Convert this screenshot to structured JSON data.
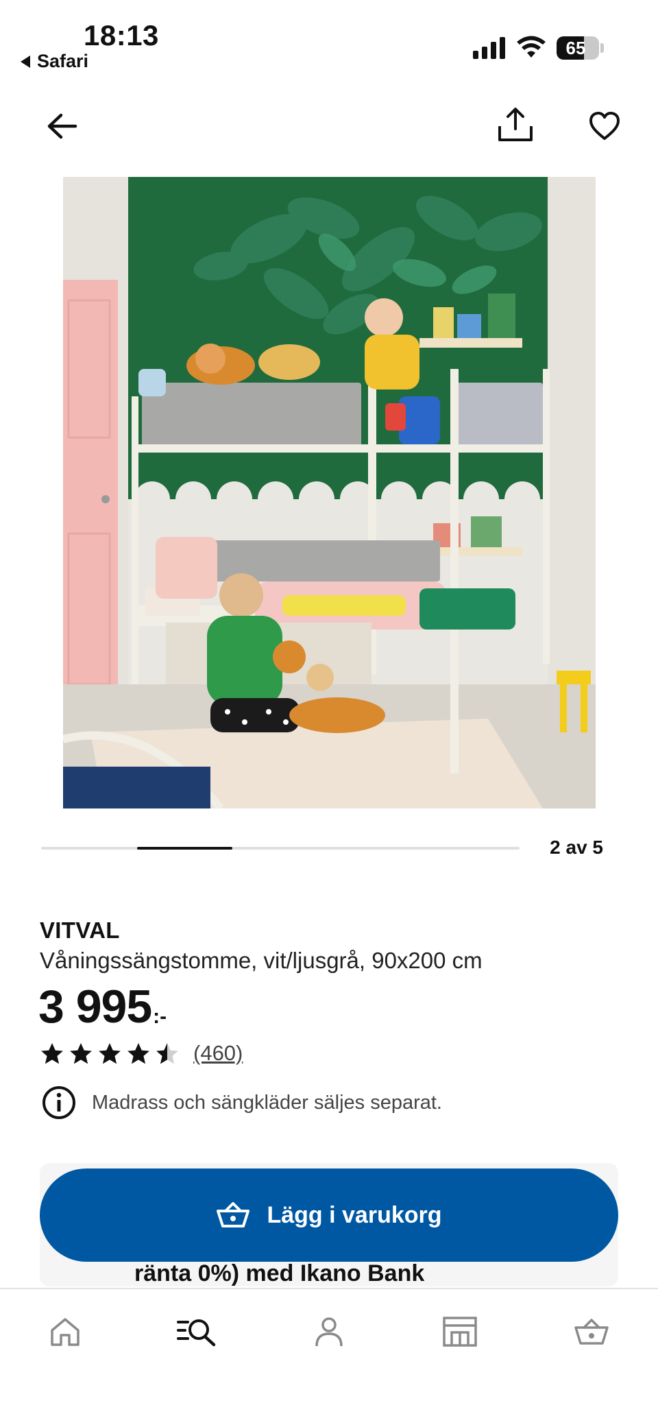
{
  "status_bar": {
    "time": "18:13",
    "back_app_label": "Safari",
    "battery_percent": 65,
    "battery_label": "65"
  },
  "top_nav": {
    "back_icon": "arrow-left-icon",
    "share_icon": "share-icon",
    "favorite_icon": "heart-icon"
  },
  "carousel": {
    "current": 2,
    "total": 5,
    "counter_label": "2 av 5"
  },
  "product": {
    "name": "VITVAL",
    "description": "Våningssängstomme, vit/ljusgrå, 90x200 cm",
    "price": "3 995",
    "price_suffix": ":-",
    "rating": 4.5,
    "max_rating": 5,
    "review_count_label": "(460)",
    "notice": "Madrass och sängkläder säljes separat."
  },
  "cart": {
    "button_label": "Lägg i varukorg",
    "finance_text": "ränta 0%) med Ikano Bank"
  },
  "tab_bar": {
    "items": [
      {
        "icon": "home-icon"
      },
      {
        "icon": "search-icon",
        "active": true
      },
      {
        "icon": "profile-icon"
      },
      {
        "icon": "store-icon"
      },
      {
        "icon": "cart-icon"
      }
    ]
  },
  "colors": {
    "accent_blue": "#0058a3",
    "text": "#111111",
    "muted": "#444444"
  }
}
